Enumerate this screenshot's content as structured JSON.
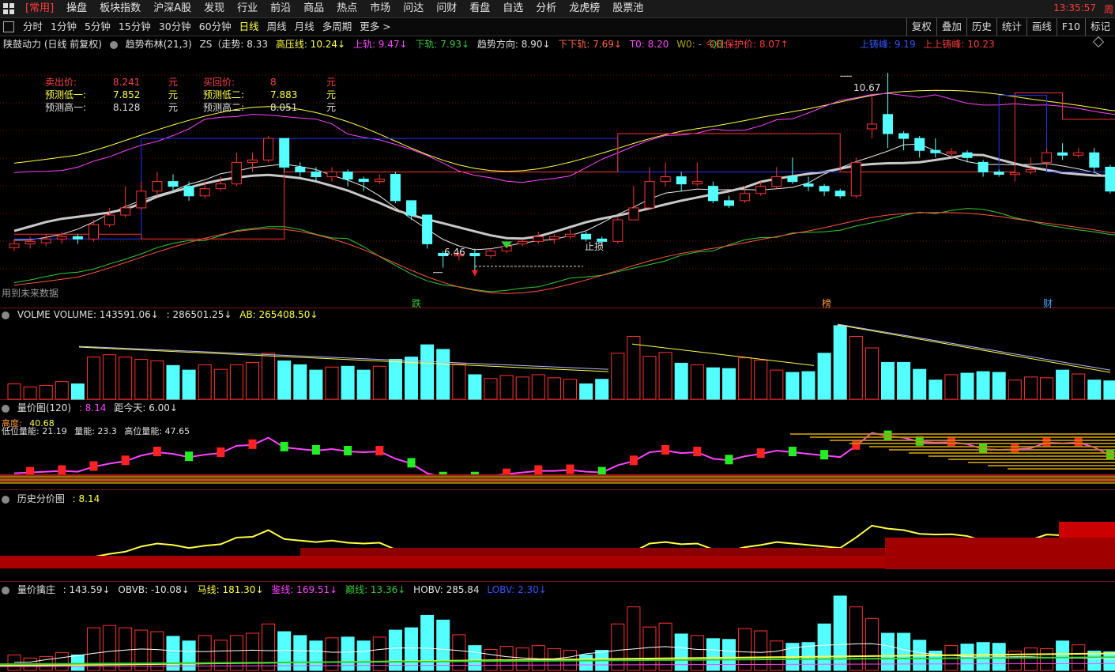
{
  "menu": {
    "items": [
      "[常用]",
      "操盘",
      "板块指数",
      "沪深A股",
      "发现",
      "行业",
      "前沿",
      "商品",
      "热点",
      "市场",
      "问达",
      "问财",
      "看盘",
      "自选",
      "分析",
      "龙虎榜",
      "股票池"
    ],
    "clock": "13:35:57"
  },
  "toolbar": {
    "periods": [
      "分时",
      "1分钟",
      "5分钟",
      "15分钟",
      "30分钟",
      "60分钟",
      "日线",
      "周线",
      "月线",
      "多周期",
      "更多 >"
    ],
    "selected": "日线",
    "right": [
      "复权",
      "叠加",
      "历史",
      "统计",
      "画线",
      "F10",
      "标记"
    ]
  },
  "main_header": {
    "stock": "陕鼓动力 (日线 前复权)",
    "indicator": "趋势布林(21,3)",
    "zs": "ZS（走势: 8.33",
    "gaoya": "高压线: 10.24↓",
    "shangui": "上轨: 9.47↓",
    "xiagui": "下轨: 7.93↓",
    "direction": "趋势方向: 8.90↓",
    "xiaxiagui": "下下轨: 7.69↓",
    "t0": "T0: 8.20",
    "w0": "W0: -",
    "q0": "Q0: -",
    "protect": "今日保护价: 8.07↑",
    "shangfeng": "上铸峰: 9.19",
    "shangshang": "上上铸峰: 10.23"
  },
  "price_table": {
    "rows": [
      {
        "l1": "卖出价:",
        "v1": "8.241",
        "u1": "元",
        "l2": "买回价:",
        "v2": "8",
        "u2": "元"
      },
      {
        "l1": "预测低一:",
        "v1": "7.852",
        "u1": "元",
        "l2": "预测低二:",
        "v2": "7.883",
        "u2": "元"
      },
      {
        "l1": "预测高一:",
        "v1": "8.128",
        "u1": "元",
        "l2": "预测高二:",
        "v2": "8.051",
        "u2": "元"
      }
    ]
  },
  "annotations": {
    "high": "10.67",
    "low": "6.46",
    "stop": "止损",
    "future": "用到未来数据",
    "tag1": "跌",
    "tag2": "榜",
    "tag3": "财"
  },
  "vol_header": {
    "name": "VOLME VOLUME: 143591.06↓",
    "v2": ": 286501.25↓",
    "ab": "AB: 265408.50↓"
  },
  "lp_header": {
    "name": "量价图(120)",
    "val": ": 8.14",
    "days": "距今天: 6.00↓",
    "l1": "高度:",
    "l1v": "40.68",
    "l2": "低位量能: 21.19",
    "l3": "量能: 23.3",
    "l4": "高位量能: 47.65"
  },
  "hist_header": {
    "name": "历史分价图",
    "val": ": 8.14"
  },
  "qz_header": {
    "name": "量价擒庄",
    "val": ": 143.59↓",
    "obvb": "OBVB: -10.08↓",
    "ma": "马线: 181.30↓",
    "jian": "鉴线: 169.51↓",
    "dian": "巅线: 13.36↓",
    "hobv": "HOBV: 285.84",
    "lobv": "LOBV: 2.30↓"
  },
  "colors": {
    "up": "#ff3232",
    "down": "#54ffff",
    "yellow": "#ffff44",
    "magenta": "#ff44ff",
    "green": "#33cc33",
    "blue": "#2233ff",
    "grid": "#7a1010"
  },
  "chart_data": {
    "type": "candlestick",
    "price_ylim": [
      6.0,
      11.2
    ],
    "candles": [
      {
        "o": 7.02,
        "c": 7.1,
        "h": 7.2,
        "l": 6.95
      },
      {
        "o": 7.1,
        "c": 7.15,
        "h": 7.25,
        "l": 7.0
      },
      {
        "o": 7.12,
        "c": 7.2,
        "h": 7.3,
        "l": 7.05
      },
      {
        "o": 7.2,
        "c": 7.25,
        "h": 7.35,
        "l": 7.1
      },
      {
        "o": 7.25,
        "c": 7.2,
        "h": 7.3,
        "l": 7.1
      },
      {
        "o": 7.2,
        "c": 7.5,
        "h": 7.6,
        "l": 7.15
      },
      {
        "o": 7.5,
        "c": 7.7,
        "h": 7.85,
        "l": 7.45
      },
      {
        "o": 7.7,
        "c": 7.85,
        "h": 8.3,
        "l": 7.65
      },
      {
        "o": 7.85,
        "c": 8.2,
        "h": 8.4,
        "l": 7.8
      },
      {
        "o": 8.2,
        "c": 8.4,
        "h": 8.6,
        "l": 8.1
      },
      {
        "o": 8.4,
        "c": 8.3,
        "h": 8.55,
        "l": 8.2
      },
      {
        "o": 8.3,
        "c": 8.1,
        "h": 8.4,
        "l": 8.0
      },
      {
        "o": 8.1,
        "c": 8.25,
        "h": 8.4,
        "l": 8.05
      },
      {
        "o": 8.25,
        "c": 8.35,
        "h": 8.5,
        "l": 8.2
      },
      {
        "o": 8.35,
        "c": 8.8,
        "h": 9.0,
        "l": 8.3
      },
      {
        "o": 8.8,
        "c": 8.85,
        "h": 9.0,
        "l": 8.6
      },
      {
        "o": 8.85,
        "c": 9.3,
        "h": 9.35,
        "l": 8.8
      },
      {
        "o": 9.3,
        "c": 8.7,
        "h": 9.3,
        "l": 8.6
      },
      {
        "o": 8.7,
        "c": 8.6,
        "h": 8.8,
        "l": 8.5
      },
      {
        "o": 8.6,
        "c": 8.5,
        "h": 8.7,
        "l": 8.4
      },
      {
        "o": 8.5,
        "c": 8.6,
        "h": 8.7,
        "l": 8.4
      },
      {
        "o": 8.6,
        "c": 8.45,
        "h": 8.65,
        "l": 8.3
      },
      {
        "o": 8.45,
        "c": 8.4,
        "h": 8.5,
        "l": 8.2
      },
      {
        "o": 8.4,
        "c": 8.45,
        "h": 8.55,
        "l": 8.35
      },
      {
        "o": 8.55,
        "c": 8.0,
        "h": 8.6,
        "l": 7.95
      },
      {
        "o": 8.0,
        "c": 7.7,
        "h": 8.0,
        "l": 7.6
      },
      {
        "o": 7.7,
        "c": 7.1,
        "h": 7.7,
        "l": 7.0
      },
      {
        "o": 6.9,
        "c": 6.85,
        "h": 6.95,
        "l": 6.6
      },
      {
        "o": 6.85,
        "c": 6.88,
        "h": 6.95,
        "l": 6.75
      },
      {
        "o": 6.9,
        "c": 6.85,
        "h": 7.0,
        "l": 6.46
      },
      {
        "o": 6.85,
        "c": 6.95,
        "h": 7.0,
        "l": 6.8
      },
      {
        "o": 6.95,
        "c": 7.05,
        "h": 7.1,
        "l": 6.9
      },
      {
        "o": 7.1,
        "c": 7.15,
        "h": 7.2,
        "l": 7.05
      },
      {
        "o": 7.15,
        "c": 7.25,
        "h": 7.35,
        "l": 7.1
      },
      {
        "o": 7.2,
        "c": 7.25,
        "h": 7.3,
        "l": 7.1
      },
      {
        "o": 7.25,
        "c": 7.3,
        "h": 7.4,
        "l": 7.2
      },
      {
        "o": 7.3,
        "c": 7.2,
        "h": 7.35,
        "l": 7.15
      },
      {
        "o": 7.2,
        "c": 7.15,
        "h": 7.25,
        "l": 7.05
      },
      {
        "o": 7.15,
        "c": 7.6,
        "h": 7.65,
        "l": 7.1
      },
      {
        "o": 7.6,
        "c": 7.85,
        "h": 8.3,
        "l": 7.6
      },
      {
        "o": 7.85,
        "c": 8.4,
        "h": 8.7,
        "l": 7.85
      },
      {
        "o": 8.4,
        "c": 8.5,
        "h": 8.8,
        "l": 8.3
      },
      {
        "o": 8.5,
        "c": 8.35,
        "h": 8.6,
        "l": 8.2
      },
      {
        "o": 8.35,
        "c": 8.4,
        "h": 8.8,
        "l": 8.3
      },
      {
        "o": 8.3,
        "c": 8.0,
        "h": 8.4,
        "l": 7.95
      },
      {
        "o": 8.0,
        "c": 7.9,
        "h": 8.1,
        "l": 7.85
      },
      {
        "o": 8.0,
        "c": 8.15,
        "h": 8.3,
        "l": 7.95
      },
      {
        "o": 8.15,
        "c": 8.3,
        "h": 8.4,
        "l": 8.1
      },
      {
        "o": 8.3,
        "c": 8.5,
        "h": 8.7,
        "l": 8.25
      },
      {
        "o": 8.5,
        "c": 8.4,
        "h": 8.9,
        "l": 8.35
      },
      {
        "o": 8.35,
        "c": 8.3,
        "h": 8.5,
        "l": 8.2
      },
      {
        "o": 8.3,
        "c": 8.2,
        "h": 8.35,
        "l": 8.1
      },
      {
        "o": 8.2,
        "c": 8.1,
        "h": 8.25,
        "l": 8.05
      },
      {
        "o": 8.1,
        "c": 8.8,
        "h": 8.9,
        "l": 8.05
      },
      {
        "o": 9.5,
        "c": 9.6,
        "h": 10.2,
        "l": 9.3
      },
      {
        "o": 9.8,
        "c": 9.4,
        "h": 10.67,
        "l": 9.1
      },
      {
        "o": 9.4,
        "c": 9.3,
        "h": 9.45,
        "l": 9.05
      },
      {
        "o": 9.3,
        "c": 9.05,
        "h": 9.35,
        "l": 8.9
      },
      {
        "o": 9.05,
        "c": 9.0,
        "h": 9.3,
        "l": 8.9
      },
      {
        "o": 9.0,
        "c": 9.02,
        "h": 9.1,
        "l": 8.9
      },
      {
        "o": 9.0,
        "c": 8.9,
        "h": 9.05,
        "l": 8.8
      },
      {
        "o": 8.8,
        "c": 8.6,
        "h": 8.85,
        "l": 8.5
      },
      {
        "o": 8.6,
        "c": 8.55,
        "h": 8.65,
        "l": 8.5
      },
      {
        "o": 8.55,
        "c": 8.58,
        "h": 8.65,
        "l": 8.4
      },
      {
        "o": 8.6,
        "c": 8.65,
        "h": 8.9,
        "l": 8.55
      },
      {
        "o": 8.8,
        "c": 9.0,
        "h": 9.1,
        "l": 8.7
      },
      {
        "o": 9.0,
        "c": 8.95,
        "h": 9.2,
        "l": 8.85
      },
      {
        "o": 8.95,
        "c": 9.0,
        "h": 9.1,
        "l": 8.9
      },
      {
        "o": 9.0,
        "c": 8.7,
        "h": 9.1,
        "l": 8.6
      },
      {
        "o": 8.7,
        "c": 8.2,
        "h": 8.75,
        "l": 8.15
      },
      {
        "o": 8.2,
        "c": 8.15,
        "h": 8.2,
        "l": 8.05
      },
      {
        "o": 8.1,
        "c": 8.12,
        "h": 8.2,
        "l": 8.05
      },
      {
        "o": 8.05,
        "c": 8.2,
        "h": 8.25,
        "l": 8.0
      },
      {
        "o": 8.2,
        "c": 8.14,
        "h": 8.3,
        "l": 8.05
      }
    ],
    "volumes": [
      2,
      1.6,
      1.8,
      2.3,
      2.0,
      5.5,
      5.8,
      5.5,
      5.2,
      5.0,
      4.4,
      3.8,
      4.5,
      3.9,
      4.5,
      4.8,
      6.0,
      5.0,
      4.5,
      3.8,
      4.2,
      4.3,
      3.8,
      4.3,
      5.2,
      5.5,
      7.1,
      6.5,
      4.6,
      3.2,
      2.7,
      3.1,
      2.9,
      3.2,
      2.8,
      2.6,
      2.0,
      2.6,
      6.0,
      8.2,
      5.6,
      6.1,
      4.7,
      4.5,
      4.1,
      4.0,
      5.4,
      5.1,
      3.8,
      3.5,
      3.6,
      6.0,
      9.6,
      8.2,
      6.7,
      4.8,
      4.8,
      3.9,
      2.5,
      3.2,
      3.4,
      3.6,
      3.5,
      2.5,
      2.9,
      2.8,
      3.8,
      3.3,
      2.5,
      2.4,
      2.6,
      2.2
    ]
  }
}
